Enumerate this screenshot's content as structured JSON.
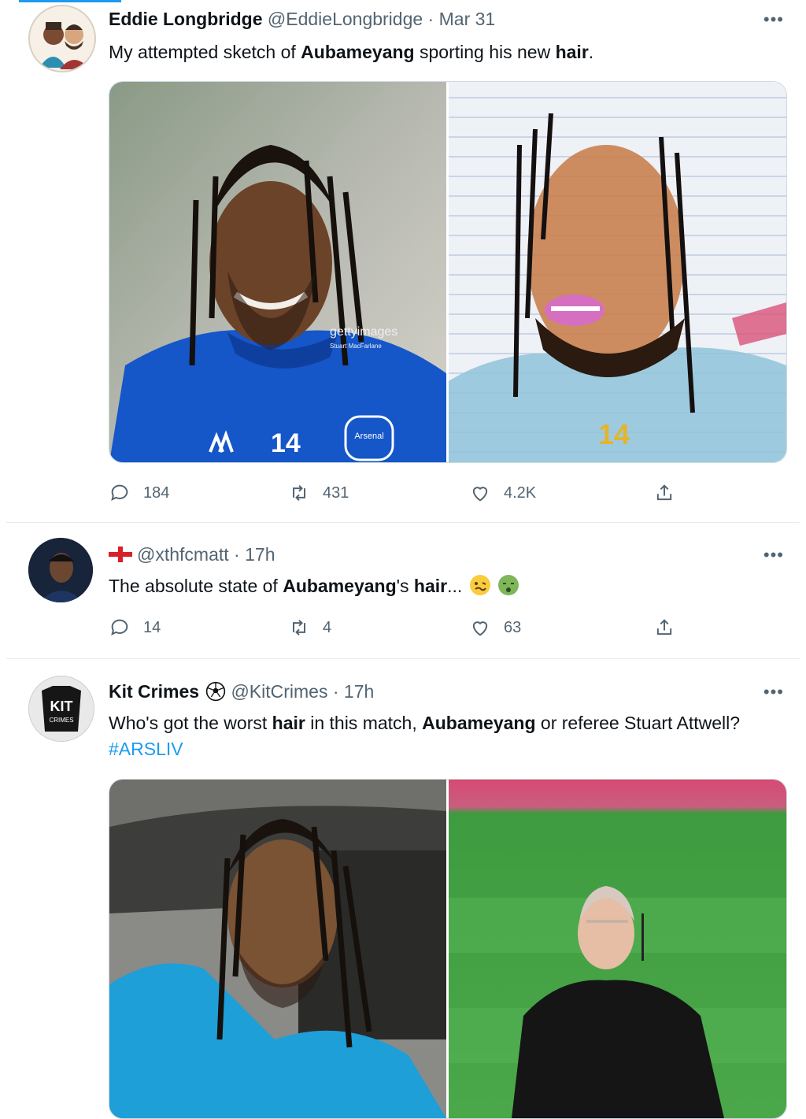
{
  "tweets": [
    {
      "name": "Eddie Longbridge",
      "handle": "@EddieLongbridge",
      "sep": " · ",
      "time": "Mar 31",
      "more": "•••",
      "text_parts": [
        "My attempted sketch of ",
        "Aubameyang",
        " sporting his new ",
        "hair",
        "."
      ],
      "media": {
        "watermark": "gettyimages",
        "credit": "Stuart MacFarlane",
        "shirt_number_photo": "14",
        "crest_text": "Arsenal",
        "shirt_number_sketch": "14"
      },
      "replies": "184",
      "retweets": "431",
      "likes": "4.2K"
    },
    {
      "flag": "england-flag",
      "handle": "@xthfcmatt",
      "sep": " · ",
      "time": "17h",
      "more": "•••",
      "text_parts": [
        "The absolute state of ",
        "Aubameyang",
        "'s ",
        "hair",
        "..."
      ],
      "emojis": [
        "woozy-face-emoji",
        "nauseated-face-emoji"
      ],
      "replies": "14",
      "retweets": "4",
      "likes": "63"
    },
    {
      "name": "Kit Crimes",
      "name_icon": "soccer-ball-icon",
      "handle": "@KitCrimes",
      "sep": " · ",
      "time": "17h",
      "more": "•••",
      "avatar_text": "KIT",
      "avatar_subtext": "CRIMES",
      "text_parts": [
        "Who's got the worst ",
        "hair",
        " in this match, ",
        "Aubameyang",
        " or referee Stuart Attwell? "
      ],
      "hashtag": "#ARSLIV"
    }
  ],
  "colors": {
    "accent": "#1d9bf0",
    "secondary_text": "#536471",
    "border": "#e6ecf0"
  }
}
